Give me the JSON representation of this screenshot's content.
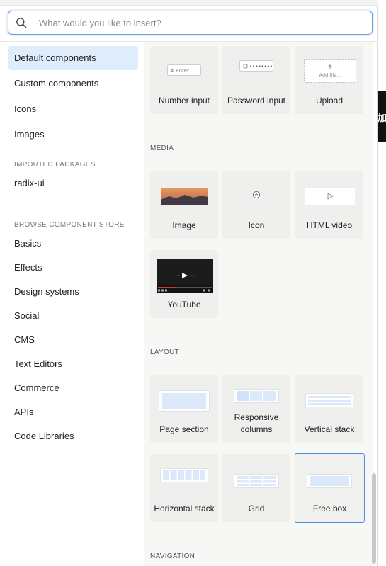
{
  "search": {
    "placeholder": "What would you like to insert?",
    "value": ""
  },
  "sidebar": {
    "items": [
      {
        "label": "Default components",
        "active": true
      },
      {
        "label": "Custom components"
      },
      {
        "label": "Icons"
      },
      {
        "label": "Images"
      }
    ],
    "imported_heading": "IMPORTED PACKAGES",
    "imported_items": [
      {
        "label": "radix-ui"
      }
    ],
    "store_heading": "BROWSE COMPONENT STORE",
    "store_items": [
      {
        "label": "Basics"
      },
      {
        "label": "Effects"
      },
      {
        "label": "Design systems"
      },
      {
        "label": "Social"
      },
      {
        "label": "CMS"
      },
      {
        "label": "Text Editors"
      },
      {
        "label": "Commerce"
      },
      {
        "label": "APIs"
      },
      {
        "label": "Code Libraries"
      }
    ]
  },
  "content": {
    "forms": {
      "cards": [
        {
          "label": "Number input",
          "thumb_text": "# Enter..."
        },
        {
          "label": "Password input",
          "thumb_text": "••••••••"
        },
        {
          "label": "Upload",
          "thumb_text": "Add file..."
        }
      ]
    },
    "media": {
      "heading": "MEDIA",
      "cards": [
        {
          "label": "Image"
        },
        {
          "label": "Icon"
        },
        {
          "label": "HTML video"
        },
        {
          "label": "YouTube"
        }
      ]
    },
    "layout": {
      "heading": "LAYOUT",
      "cards": [
        {
          "label": "Page section"
        },
        {
          "label": "Responsive columns"
        },
        {
          "label": "Vertical stack"
        },
        {
          "label": "Horizontal stack"
        },
        {
          "label": "Grid"
        },
        {
          "label": "Free box",
          "selected": true
        }
      ]
    },
    "navigation": {
      "heading": "NAVIGATION"
    }
  },
  "background_fragment": {
    "text": "加"
  },
  "colors": {
    "accent": "#4a8fd8",
    "active_bg": "#dfecfb",
    "card_bg": "#efefed",
    "thumb_blue": "#dbe9fb"
  }
}
